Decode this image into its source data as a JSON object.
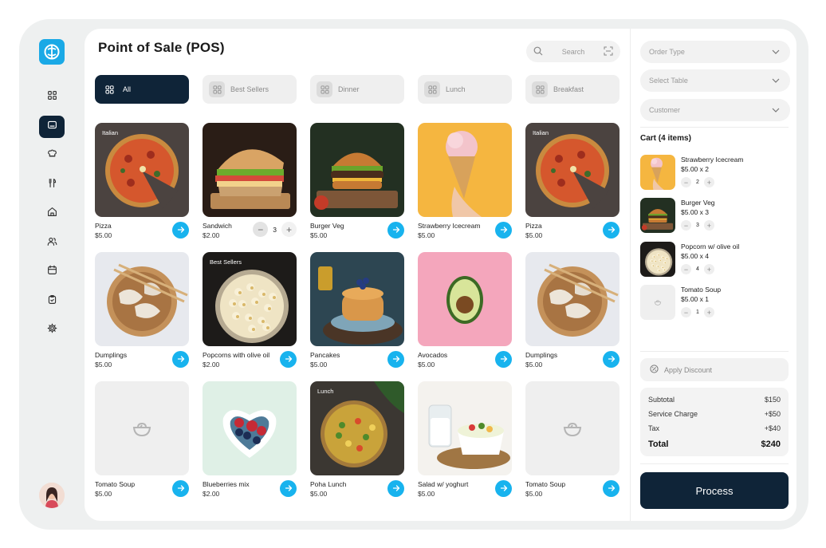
{
  "app": {
    "title": "Point of Sale (POS)"
  },
  "search": {
    "placeholder": "Search"
  },
  "categories": [
    {
      "label": "All",
      "active": true
    },
    {
      "label": "Best Sellers"
    },
    {
      "label": "Dinner"
    },
    {
      "label": "Lunch"
    },
    {
      "label": "Breakfast"
    }
  ],
  "sidebar": {
    "items": [
      {
        "icon": "dashboard-icon"
      },
      {
        "icon": "pos-terminal-icon",
        "active": true
      },
      {
        "icon": "chef-hat-icon"
      },
      {
        "icon": "utensils-icon"
      },
      {
        "icon": "store-icon"
      },
      {
        "icon": "users-icon"
      },
      {
        "icon": "calendar-icon"
      },
      {
        "icon": "clipboard-icon"
      },
      {
        "icon": "settings-icon"
      }
    ]
  },
  "products": [
    {
      "name": "Pizza",
      "price": "$5.00",
      "tag": "Italian",
      "image": "pizza"
    },
    {
      "name": "Sandwich",
      "price": "$2.00",
      "tag": "",
      "image": "sandwich",
      "quantity": "3"
    },
    {
      "name": "Burger Veg",
      "price": "$5.00",
      "tag": "",
      "image": "burger"
    },
    {
      "name": "Strawberry Icecream",
      "price": "$5.00",
      "tag": "",
      "image": "icecream"
    },
    {
      "name": "Pizza",
      "price": "$5.00",
      "tag": "Italian",
      "image": "pizza"
    },
    {
      "name": "Dumplings",
      "price": "$5.00",
      "tag": "",
      "image": "dumplings"
    },
    {
      "name": "Popcorns with olive oil",
      "price": "$2.00",
      "tag": "Best Sellers",
      "image": "popcorn"
    },
    {
      "name": "Pancakes",
      "price": "$5.00",
      "tag": "",
      "image": "pancakes"
    },
    {
      "name": "Avocados",
      "price": "$5.00",
      "tag": "",
      "image": "avocado"
    },
    {
      "name": "Dumplings",
      "price": "$5.00",
      "tag": "",
      "image": "dumplings"
    },
    {
      "name": "Tomato Soup",
      "price": "$5.00",
      "tag": "",
      "image": "placeholder"
    },
    {
      "name": "Blueberries mix",
      "price": "$2.00",
      "tag": "",
      "image": "berries"
    },
    {
      "name": "Poha Lunch",
      "price": "$5.00",
      "tag": "Lunch",
      "image": "poha"
    },
    {
      "name": "Salad w/ yoghurt",
      "price": "$5.00",
      "tag": "",
      "image": "salad"
    },
    {
      "name": "Tomato Soup",
      "price": "$5.00",
      "tag": "",
      "image": "placeholder"
    }
  ],
  "order": {
    "order_type": "Order Type",
    "select_table": "Select Table",
    "customer": "Customer"
  },
  "cart": {
    "title": "Cart (4 items)",
    "items": [
      {
        "name": "Strawberry Icecream",
        "qty_line": "$5.00 x 2",
        "qty": "2",
        "image": "icecream"
      },
      {
        "name": "Burger Veg",
        "qty_line": "$5.00 x 3",
        "qty": "3",
        "image": "burger"
      },
      {
        "name": "Popcorn w/ olive oil",
        "qty_line": "$5.00 x 4",
        "qty": "4",
        "image": "popcorn"
      },
      {
        "name": "Tomato Soup",
        "qty_line": "$5.00 x 1",
        "qty": "1",
        "image": "placeholder"
      }
    ]
  },
  "discount": {
    "label": "Apply Discount"
  },
  "summary": {
    "subtotal_label": "Subtotal",
    "subtotal": "$150",
    "service_label": "Service Charge",
    "service": "+$50",
    "tax_label": "Tax",
    "tax": "+$40",
    "total_label": "Total",
    "total": "$240"
  },
  "process": {
    "label": "Process"
  },
  "colors": {
    "accent": "#18b3ee",
    "dark": "#0f2438",
    "brand": "#1aa9e6"
  }
}
